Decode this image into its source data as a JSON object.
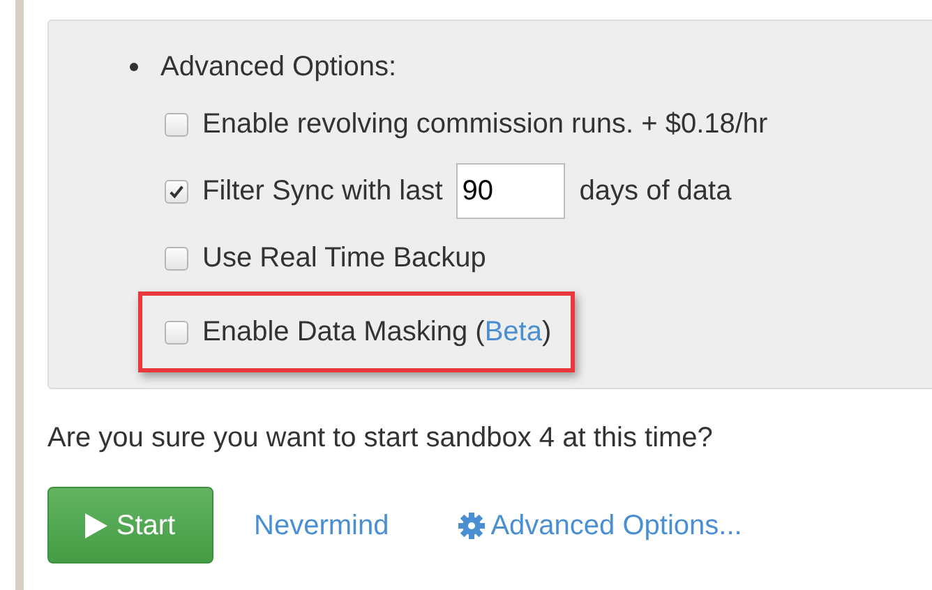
{
  "advanced_panel": {
    "heading": "Advanced Options:",
    "options": [
      {
        "kind": "checkbox",
        "checked": false,
        "highlighted": false,
        "label": "Enable revolving commission runs. + $0.18/hr"
      },
      {
        "kind": "days",
        "checked": true,
        "highlighted": false,
        "label": "Filter Sync with last",
        "value": "90",
        "suffix": "days of data"
      },
      {
        "kind": "checkbox",
        "checked": false,
        "highlighted": false,
        "label": "Use Real Time Backup"
      },
      {
        "kind": "link",
        "checked": false,
        "highlighted": true,
        "label": "Enable Data Masking (",
        "link": "Beta",
        "suffix": ")"
      }
    ]
  },
  "question": "Are you sure you want to start sandbox 4 at this time?",
  "actions": {
    "start": "Start",
    "cancel": "Nevermind",
    "advanced": "Advanced Options..."
  }
}
